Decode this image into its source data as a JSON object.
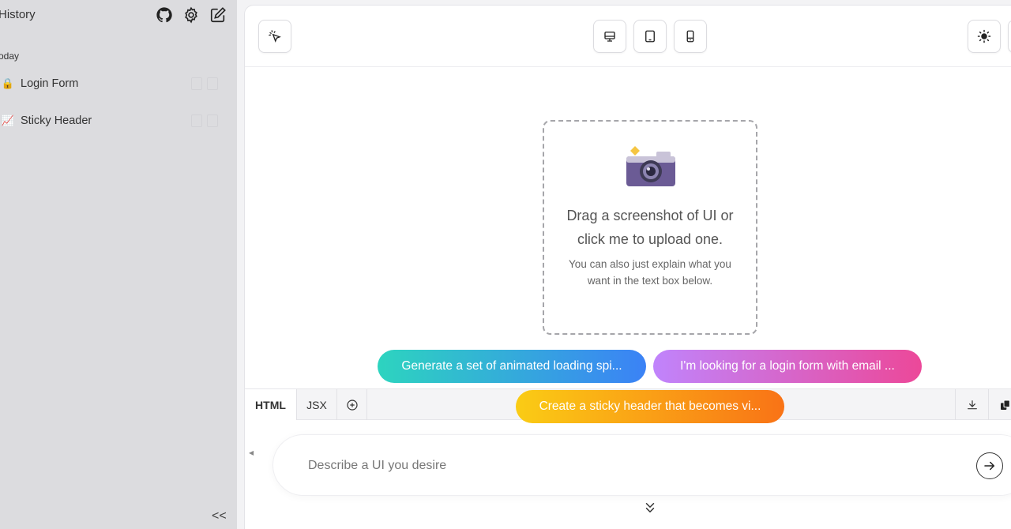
{
  "sidebar": {
    "title": "History",
    "section": "oday",
    "items": [
      {
        "emoji": "🔒",
        "label": "Login Form"
      },
      {
        "emoji": "📈",
        "label": "Sticky Header"
      }
    ],
    "collapse_label": "<<"
  },
  "dropzone": {
    "title_line1": "Drag a screenshot of UI or",
    "title_line2": "click me to upload one.",
    "sub_line1": "You can also just explain what you",
    "sub_line2": "want in the text box below."
  },
  "tabs": [
    {
      "label": "HTML"
    },
    {
      "label": "JSX"
    }
  ],
  "suggestions": [
    {
      "label": "Generate a set of animated loading spi..."
    },
    {
      "label": "I'm looking for a login form with email ..."
    },
    {
      "label": "Create a sticky header that becomes vi..."
    }
  ],
  "input": {
    "placeholder": "Describe a UI you desire"
  },
  "colors": {
    "accent_teal": "#2dd4bf",
    "accent_blue": "#3b82f6",
    "accent_purple": "#c084fc",
    "accent_pink": "#ec4899",
    "accent_yellow": "#facc15",
    "accent_orange": "#f97316"
  }
}
